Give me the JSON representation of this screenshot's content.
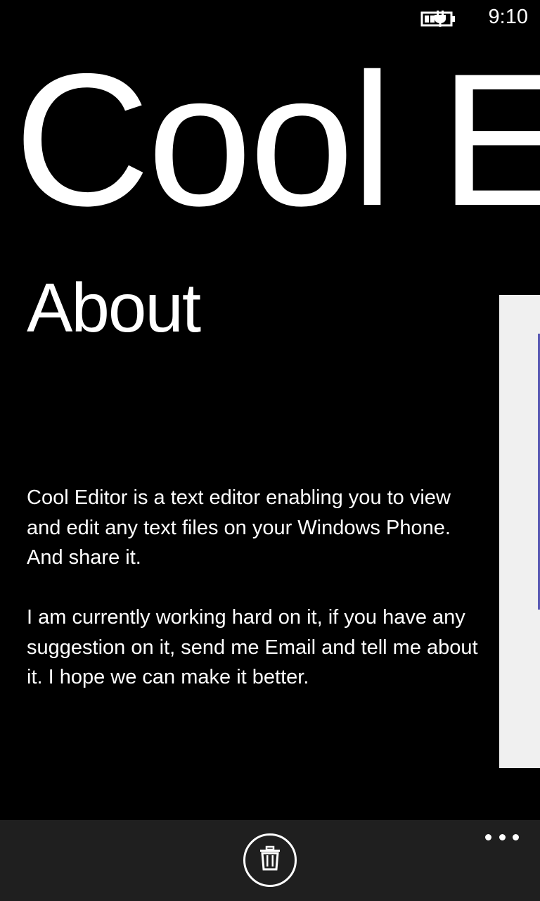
{
  "status_bar": {
    "time": "9:10",
    "battery_icon": "battery-charging-icon"
  },
  "panorama": {
    "title": "Cool Editor",
    "section_title": "About"
  },
  "about": {
    "paragraphs": [
      "Cool Editor is a text editor enabling you to view and edit any text files on your Windows Phone. And share it.",
      "I am currently working hard on it, if you have any suggestion on it, send me Email and tell me about it. I hope we can make it better."
    ]
  },
  "app_bar": {
    "primary_icon": "delete-icon",
    "more_icon": "ellipsis-icon"
  },
  "colors": {
    "background": "#000000",
    "foreground": "#ffffff",
    "app_bar": "#1f1f1f",
    "peek_panel": "#f0f0f0",
    "accent": "#5a5ab4"
  }
}
